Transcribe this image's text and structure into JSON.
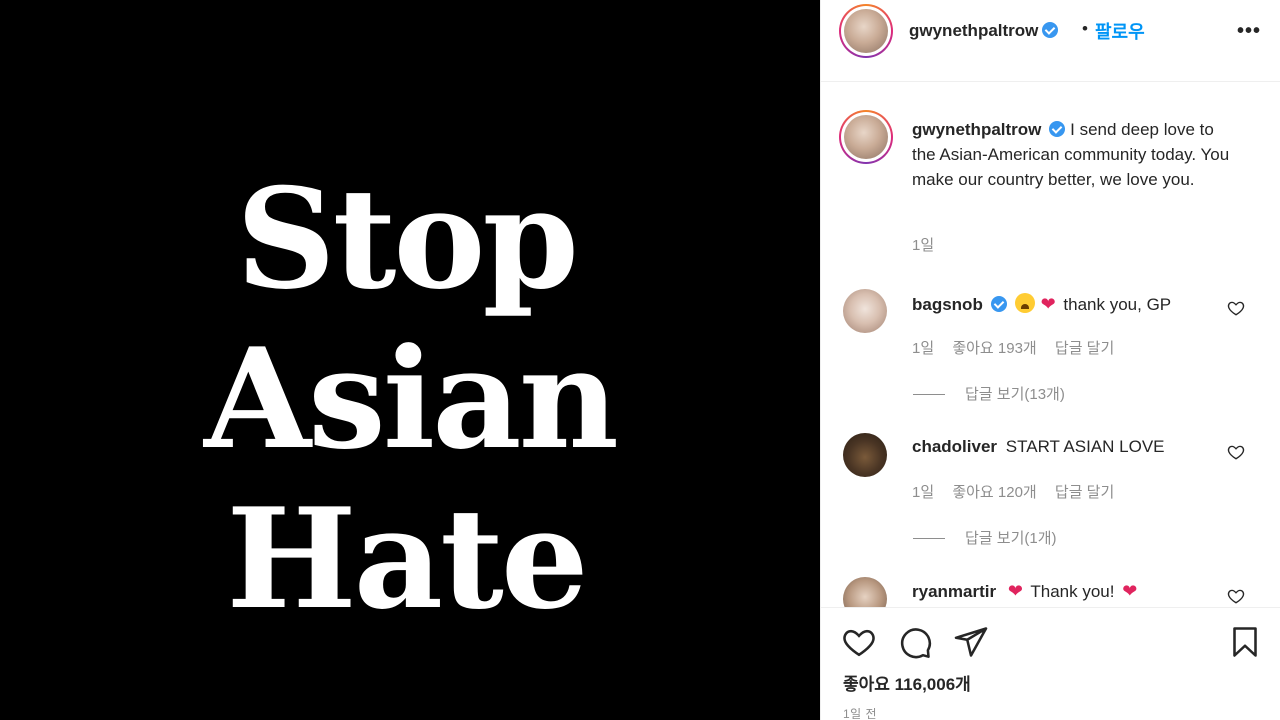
{
  "post_image": {
    "lines": [
      "Stop",
      "Asian",
      "Hate"
    ]
  },
  "header": {
    "username": "gwynethpaltrow",
    "separator": "•",
    "follow_label": "팔로우",
    "more_label": "•••"
  },
  "caption": {
    "username": "gwynethpaltrow",
    "text": "I send deep love to the Asian-American community today. You make our country better, we love you.",
    "time": "1일"
  },
  "comments": [
    {
      "username": "bagsnob",
      "verified": true,
      "text": "thank you, GP",
      "time": "1일",
      "likes": "좋아요 193개",
      "reply_label": "답글 달기",
      "view_replies": "답글 보기(13개)"
    },
    {
      "username": "chadoliver",
      "verified": false,
      "text": "START ASIAN LOVE",
      "time": "1일",
      "likes": "좋아요 120개",
      "reply_label": "답글 달기",
      "view_replies": "답글 보기(1개)"
    },
    {
      "username": "ryanmartir",
      "verified": false,
      "text": "Thank you!"
    }
  ],
  "actions": {
    "likes_label": "좋아요 116,006개",
    "posted": "1일 전"
  },
  "colors": {
    "follow": "#0095f6",
    "verified": "#3897f0",
    "secondary_text": "#8e8e8e",
    "heart": "#e0245e"
  }
}
